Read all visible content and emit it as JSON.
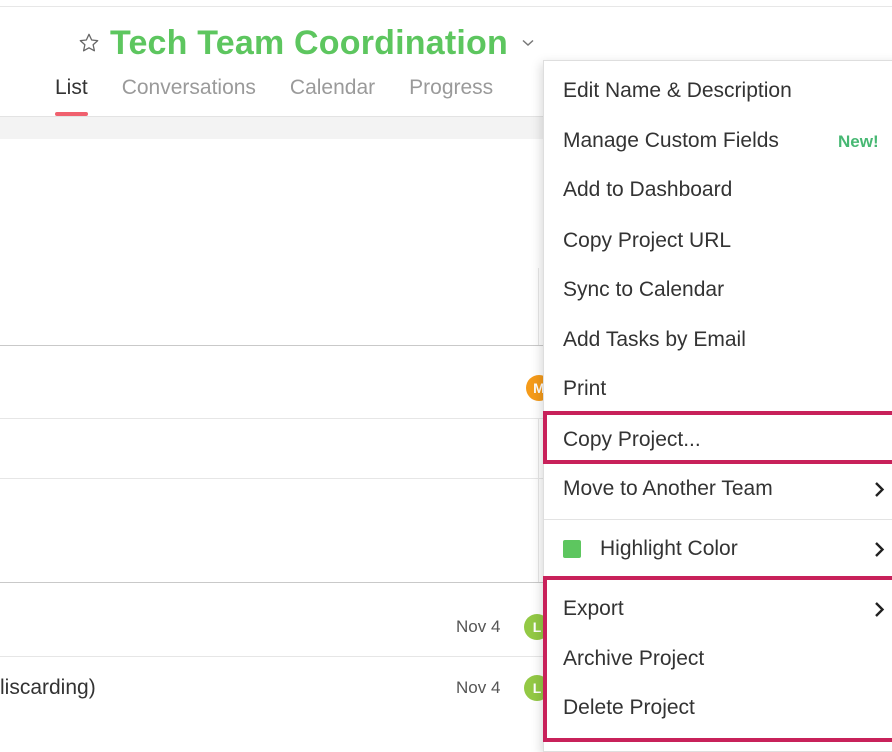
{
  "project": {
    "title": "Tech Team Coordination"
  },
  "tabs": [
    {
      "label": "List",
      "active": true
    },
    {
      "label": "Conversations",
      "active": false
    },
    {
      "label": "Calendar",
      "active": false
    },
    {
      "label": "Progress",
      "active": false
    }
  ],
  "rows": [
    {
      "text": "",
      "date": "",
      "avatar": "M",
      "avatar_color": "#f59b1a"
    },
    {
      "text": "",
      "date": "Nov 4",
      "avatar": "L",
      "avatar_color": "#93c945"
    },
    {
      "text": "liscarding)",
      "date": "Nov 4",
      "avatar": "L",
      "avatar_color": "#93c945"
    }
  ],
  "menu": {
    "items": [
      {
        "label": "Edit Name & Description"
      },
      {
        "label": "Manage Custom Fields",
        "badge": "New!"
      },
      {
        "label": "Add to Dashboard"
      },
      {
        "label": "Copy Project URL"
      },
      {
        "label": "Sync to Calendar"
      },
      {
        "label": "Add Tasks by Email"
      },
      {
        "label": "Print"
      },
      {
        "label": "Copy Project..."
      },
      {
        "label": "Move to Another Team",
        "submenu": true
      },
      {
        "label": "Highlight Color",
        "submenu": true,
        "swatch_color": "#5dc65f"
      },
      {
        "label": "Export",
        "submenu": true
      },
      {
        "label": "Archive Project"
      },
      {
        "label": "Delete Project"
      }
    ]
  },
  "colors": {
    "title_green": "#5dc65f",
    "active_tab_underline": "#f0606e",
    "highlight_box": "#c8215a",
    "new_badge": "#47b873"
  }
}
